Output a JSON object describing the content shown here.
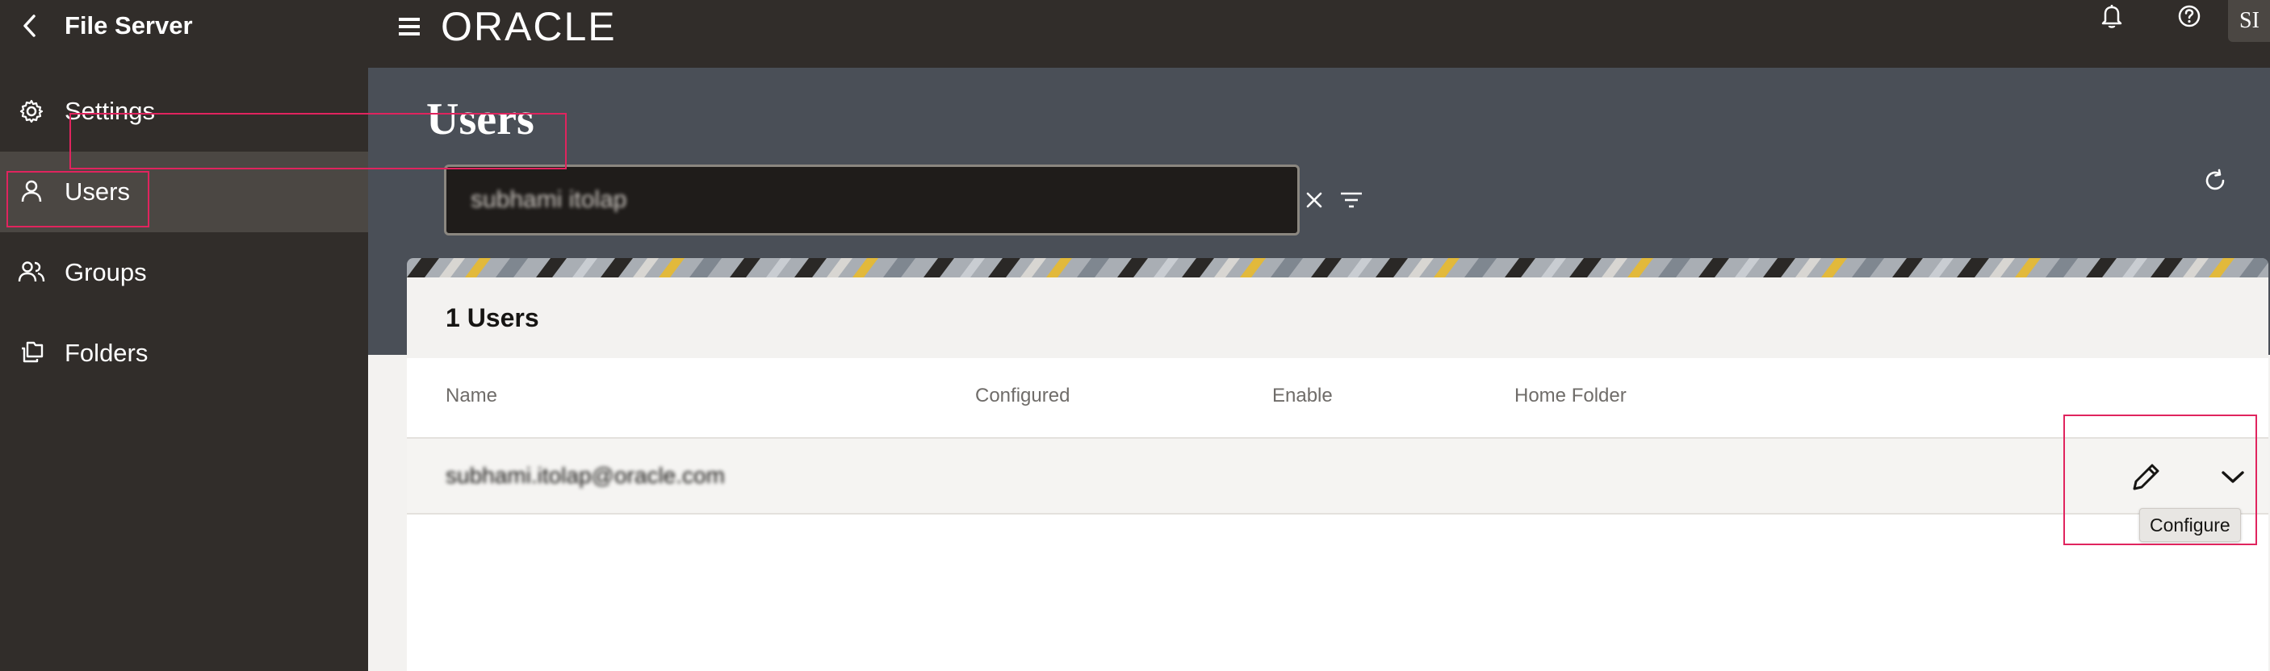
{
  "sidebar": {
    "title": "File Server",
    "items": [
      {
        "label": "Settings",
        "icon": "gear-icon"
      },
      {
        "label": "Users",
        "icon": "user-icon",
        "active": true
      },
      {
        "label": "Groups",
        "icon": "group-icon"
      },
      {
        "label": "Folders",
        "icon": "folder-icon"
      }
    ]
  },
  "topbar": {
    "logo": "ORACLE",
    "avatar_initials": "SI"
  },
  "page": {
    "title": "Users"
  },
  "search": {
    "value": "subhami itolap"
  },
  "results": {
    "count_label": "1 Users",
    "columns": [
      "Name",
      "Configured",
      "Enable",
      "Home Folder"
    ],
    "rows": [
      {
        "name": "subhami.itolap@oracle.com"
      }
    ]
  },
  "tooltip": {
    "text": "Configure"
  },
  "colors": {
    "sidebar_bg": "#312d2a",
    "band_bg": "#4a4f57",
    "highlight": "#e0245e"
  }
}
